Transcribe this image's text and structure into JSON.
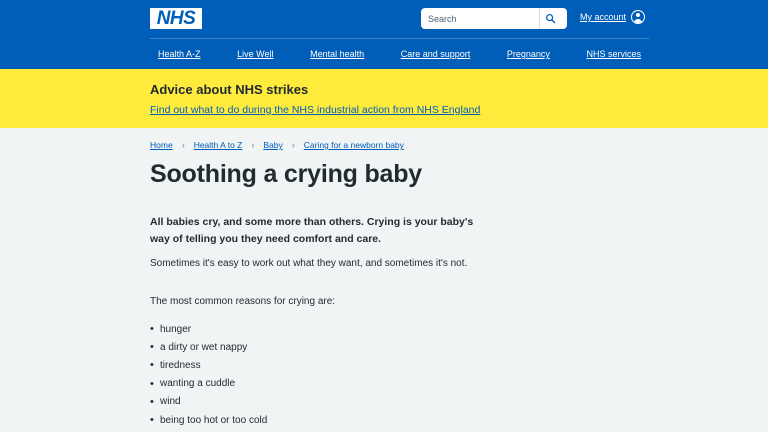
{
  "header": {
    "logo_text": "NHS",
    "search": {
      "placeholder": "Search"
    },
    "account_label": "My account",
    "nav": [
      "Health A-Z",
      "Live Well",
      "Mental health",
      "Care and support",
      "Pregnancy",
      "NHS services"
    ]
  },
  "banner": {
    "heading": "Advice about NHS strikes",
    "link": "Find out what to do during the NHS industrial action from NHS England"
  },
  "breadcrumb": [
    "Home",
    "Health A to Z",
    "Baby",
    "Caring for a newborn baby"
  ],
  "page": {
    "title": "Soothing a crying baby",
    "lede": "All babies cry, and some more than others. Crying is your baby's way of telling you they need comfort and care.",
    "para1": "Sometimes it's easy to work out what they want, and sometimes it's not.",
    "para2": "The most common reasons for crying are:",
    "reasons": [
      "hunger",
      "a dirty or wet nappy",
      "tiredness",
      "wanting a cuddle",
      "wind",
      "being too hot or too cold"
    ]
  },
  "colors": {
    "nhs_blue": "#005eb8",
    "banner_yellow": "#ffeb3b",
    "background": "#f0f4f5",
    "text": "#212b32"
  },
  "icons": {
    "search": "search-icon",
    "account": "account-icon"
  }
}
